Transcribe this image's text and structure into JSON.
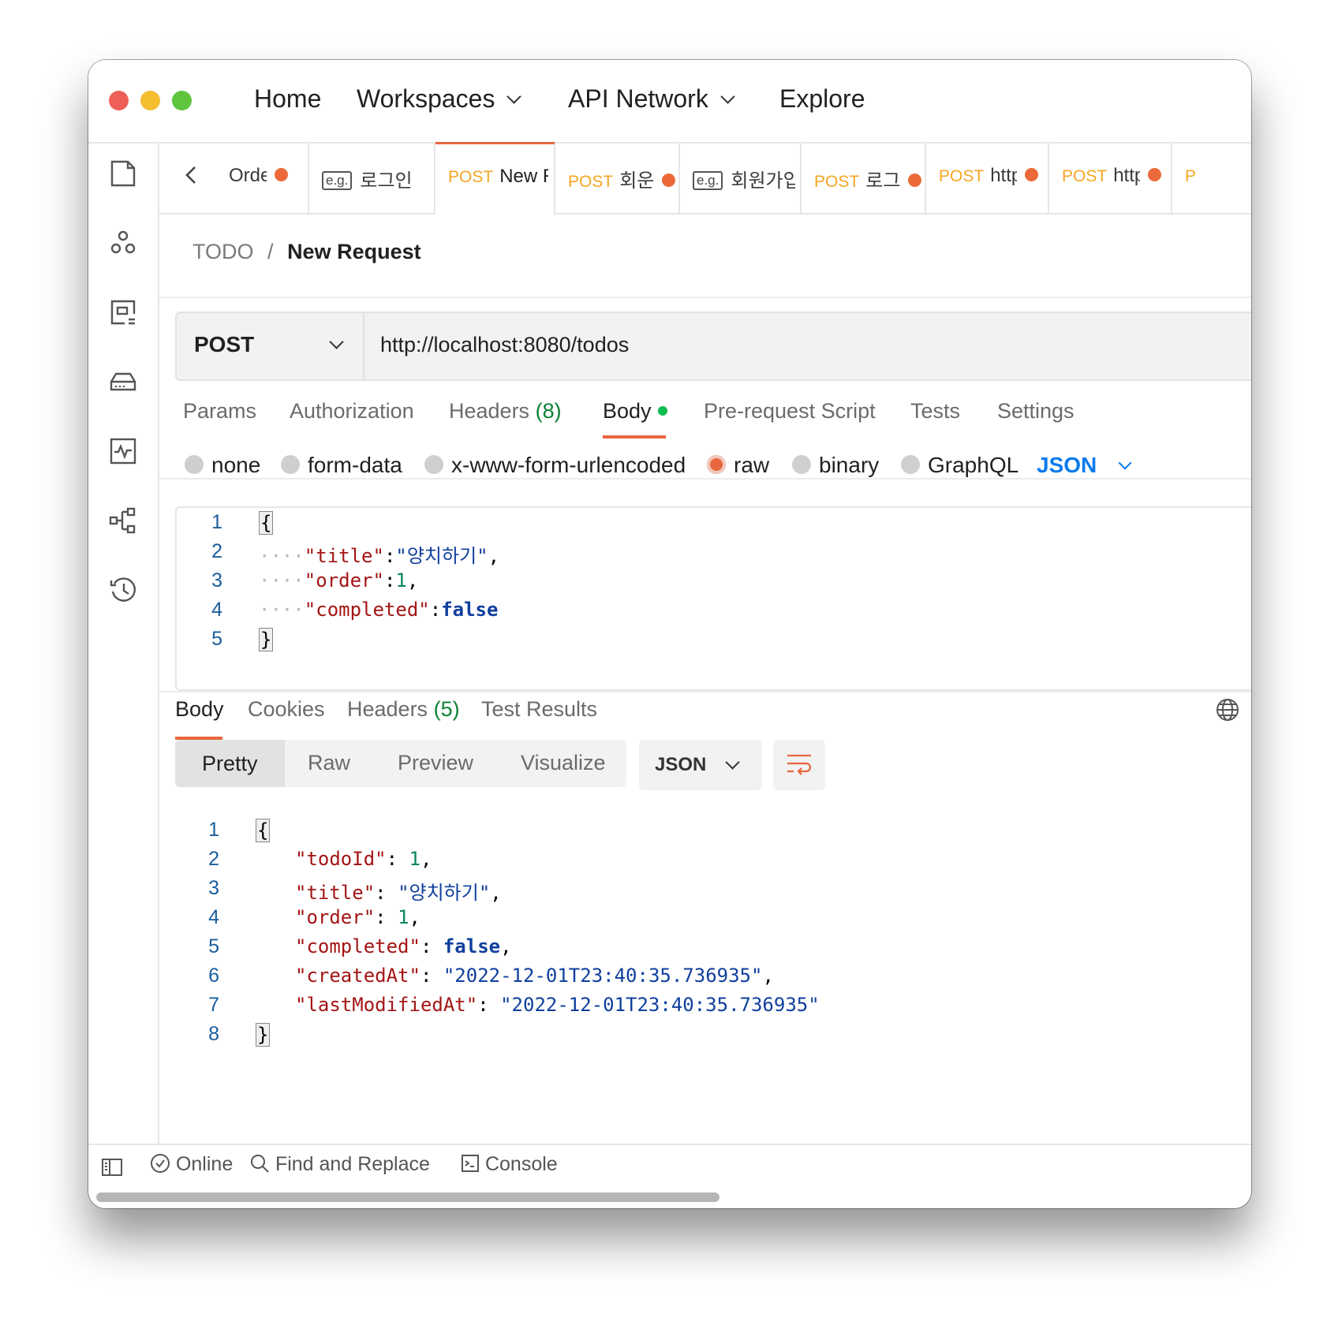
{
  "nav": {
    "home": "Home",
    "workspaces": "Workspaces",
    "api_network": "API Network",
    "explore": "Explore"
  },
  "colors": {
    "close": "#ee5f57",
    "minimize": "#f5bd30",
    "zoom": "#5fc43e",
    "accent": "#e8663d",
    "link_blue": "#097bed"
  },
  "sidebar_icons": [
    "collections-icon",
    "apis-icon",
    "environments-icon",
    "mock-servers-icon",
    "monitors-icon",
    "flows-icon",
    "history-icon"
  ],
  "tabs": [
    {
      "method": "",
      "label": "Orde",
      "dot": true,
      "eg": false
    },
    {
      "method": "",
      "label": "로그인",
      "dot": false,
      "eg": true
    },
    {
      "method": "POST",
      "label": "New R",
      "dot": false,
      "eg": false,
      "active": true
    },
    {
      "method": "POST",
      "label": "회운",
      "dot": true,
      "eg": false
    },
    {
      "method": "",
      "label": "회원가입",
      "dot": false,
      "eg": true
    },
    {
      "method": "POST",
      "label": "로그",
      "dot": true,
      "eg": false
    },
    {
      "method": "POST",
      "label": "http",
      "dot": true,
      "eg": false
    },
    {
      "method": "POST",
      "label": "http",
      "dot": true,
      "eg": false
    }
  ],
  "eg_label": "e.g.",
  "breadcrumb": {
    "collection": "TODO",
    "separator": "/",
    "request": "New Request"
  },
  "request": {
    "method": "POST",
    "url": "http://localhost:8080/todos"
  },
  "request_tabs": {
    "params": "Params",
    "authorization": "Authorization",
    "headers": "Headers",
    "headers_count": "(8)",
    "body": "Body",
    "pre_request": "Pre-request Script",
    "tests": "Tests",
    "settings": "Settings"
  },
  "body_types": {
    "none": "none",
    "form_data": "form-data",
    "urlencoded": "x-www-form-urlencoded",
    "raw": "raw",
    "binary": "binary",
    "graphql": "GraphQL",
    "format": "JSON"
  },
  "request_body": {
    "lines": [
      "1",
      "2",
      "3",
      "4",
      "5"
    ],
    "open": "{",
    "close": "}",
    "indent": "····",
    "k_title": "\"title\"",
    "v_title": "\"양치하기\"",
    "k_order": "\"order\"",
    "v_order": "1",
    "k_completed": "\"completed\"",
    "v_completed": "false"
  },
  "response_tabs": {
    "body": "Body",
    "cookies": "Cookies",
    "headers": "Headers",
    "headers_count": "(5)",
    "test_results": "Test Results"
  },
  "response_view": {
    "pretty": "Pretty",
    "raw": "Raw",
    "preview": "Preview",
    "visualize": "Visualize",
    "format": "JSON"
  },
  "response_body": {
    "lines": [
      "1",
      "2",
      "3",
      "4",
      "5",
      "6",
      "7",
      "8"
    ],
    "open": "{",
    "close": "}",
    "k_todoId": "\"todoId\"",
    "v_todoId": "1",
    "k_title": "\"title\"",
    "v_title": "\"양치하기\"",
    "k_order": "\"order\"",
    "v_order": "1",
    "k_completed": "\"completed\"",
    "v_completed": "false",
    "k_createdAt": "\"createdAt\"",
    "v_createdAt": "\"2022-12-01T23:40:35.736935\"",
    "k_lastModifiedAt": "\"lastModifiedAt\"",
    "v_lastModifiedAt": "\"2022-12-01T23:40:35.736935\""
  },
  "status_bar": {
    "online": "Online",
    "find_replace": "Find and Replace",
    "console": "Console"
  }
}
